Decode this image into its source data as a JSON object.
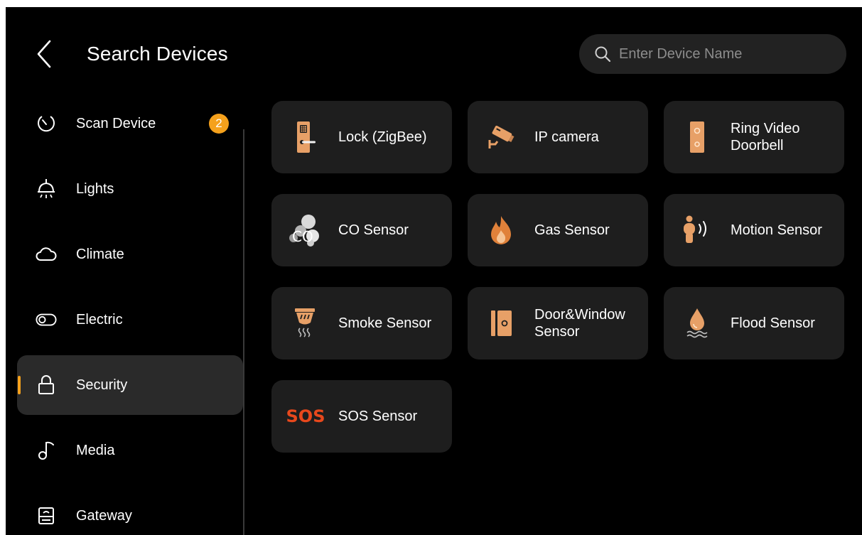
{
  "header": {
    "title": "Search Devices",
    "search_placeholder": "Enter Device Name"
  },
  "sidebar": {
    "items": [
      {
        "label": "Scan Device",
        "icon": "scan-icon",
        "badge": "2"
      },
      {
        "label": "Lights",
        "icon": "ceiling-light-icon"
      },
      {
        "label": "Climate",
        "icon": "cloud-icon"
      },
      {
        "label": "Electric",
        "icon": "toggle-switch-icon"
      },
      {
        "label": "Security",
        "icon": "lock-icon",
        "active": true
      },
      {
        "label": "Media",
        "icon": "music-note-icon"
      },
      {
        "label": "Gateway",
        "icon": "gateway-icon"
      }
    ]
  },
  "devices": [
    {
      "label": "Lock (ZigBee)",
      "icon": "door-lock-icon"
    },
    {
      "label": "IP camera",
      "icon": "ip-camera-icon"
    },
    {
      "label": "Ring Video\nDoorbell",
      "icon": "video-doorbell-icon"
    },
    {
      "label": "CO Sensor",
      "icon": "co-sensor-icon"
    },
    {
      "label": "Gas Sensor",
      "icon": "gas-flame-icon"
    },
    {
      "label": "Motion Sensor",
      "icon": "motion-sensor-icon"
    },
    {
      "label": "Smoke Sensor",
      "icon": "smoke-sensor-icon"
    },
    {
      "label": "Door&Window\nSensor",
      "icon": "door-window-sensor-icon"
    },
    {
      "label": "Flood Sensor",
      "icon": "flood-sensor-icon"
    },
    {
      "label": "SOS Sensor",
      "icon": "sos-icon",
      "icon_text": "SOS"
    }
  ],
  "colors": {
    "accent": "#f5a11c",
    "card_bg": "#1e1e1e",
    "search_bg": "#222222",
    "sos_red": "#e8481c",
    "icon_orange": "#e7a067"
  }
}
